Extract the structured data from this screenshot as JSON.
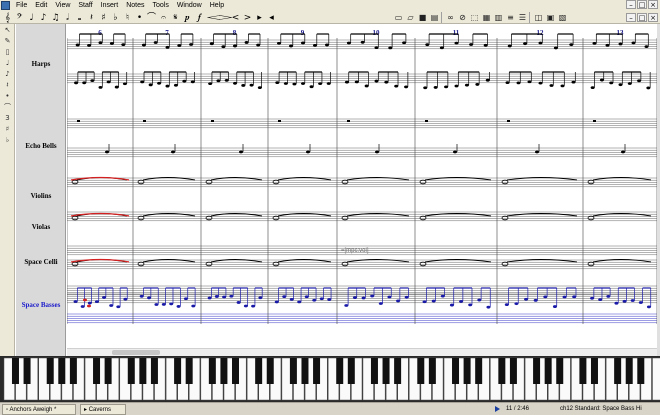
{
  "menu": [
    "File",
    "Edit",
    "View",
    "Staff",
    "Insert",
    "Notes",
    "Tools",
    "Window",
    "Help"
  ],
  "window_controls": [
    "–",
    "□",
    "×"
  ],
  "palette_icons": [
    "𝄞",
    "𝄢",
    "♩",
    "♪",
    "♫",
    "𝅗𝅥",
    "𝅝",
    "𝄽",
    "♯",
    "♭",
    "♮",
    "•",
    "⌒",
    "𝄐",
    "𝄋",
    "𝆏",
    "𝆑",
    "𝆒",
    "𝆓",
    "<",
    ">",
    "▸",
    "◂"
  ],
  "toolbar_icons": [
    "new-icon",
    "open-icon",
    "save-icon",
    "print-icon",
    "glasses-icon",
    "zoom-icon",
    "select-icon",
    "grid-icon",
    "piano-icon",
    "mixer-icon",
    "list-icon",
    "info-icon",
    "export-icon",
    "midi-icon"
  ],
  "staves": [
    {
      "name": "Harps",
      "selected": false
    },
    {
      "name": "Echo Bells",
      "selected": false
    },
    {
      "name": "Violins",
      "selected": false
    },
    {
      "name": "Violas",
      "selected": false
    },
    {
      "name": "Space Celli",
      "selected": false
    },
    {
      "name": "Space Basses",
      "selected": true
    }
  ],
  "measure_numbers": [
    "6",
    "7",
    "8",
    "9",
    "10",
    "11",
    "12",
    "13"
  ],
  "score_annotation": "=[mpc:vol]",
  "taskbar": {
    "items": [
      "Anchors Aweigh *",
      "Caverns"
    ],
    "time": "11 / 2:46",
    "status": "ch12 Standard: Space Bass Hi"
  },
  "colors": {
    "selected_staff": "#1a1acc",
    "playback_red": "#d42020",
    "toolbar_bg": "#ece9d8"
  }
}
